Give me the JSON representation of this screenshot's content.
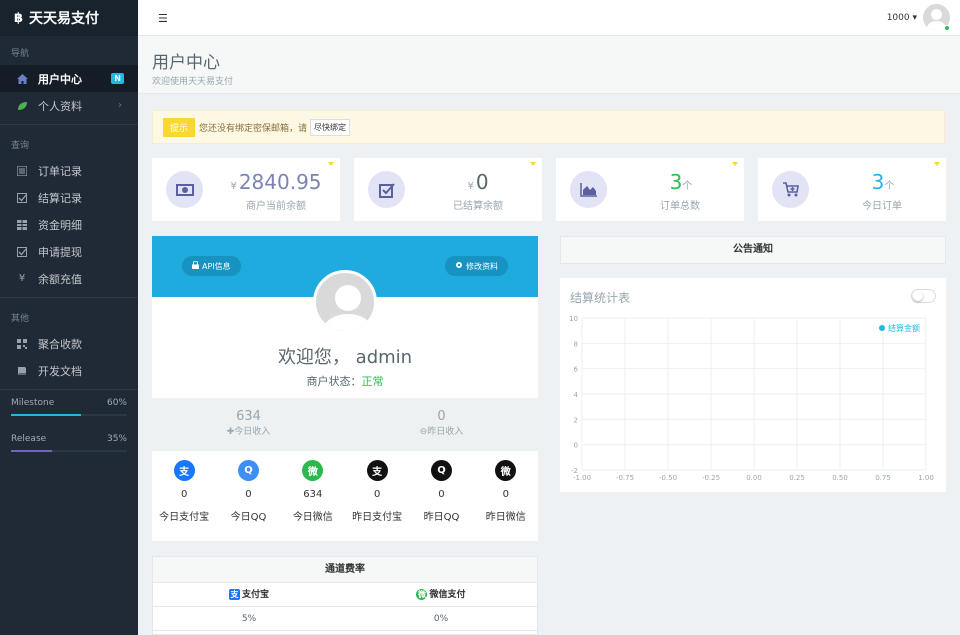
{
  "brand": {
    "logo": "฿",
    "name": "天天易支付"
  },
  "sidebar": {
    "section_nav": "导航",
    "nav_items": [
      {
        "label": "用户中心",
        "icon": "home-icon",
        "badge": "N",
        "active": true
      },
      {
        "label": "个人资料",
        "icon": "leaf-icon",
        "chevron": "›"
      }
    ],
    "section_query": "查询",
    "query_items": [
      {
        "label": "订单记录",
        "icon": "list-icon"
      },
      {
        "label": "结算记录",
        "icon": "check-icon"
      },
      {
        "label": "资金明细",
        "icon": "grid-icon"
      },
      {
        "label": "申请提现",
        "icon": "check-icon"
      },
      {
        "label": "余额充值",
        "icon": "yen-icon"
      }
    ],
    "section_other": "其他",
    "other_items": [
      {
        "label": "聚合收款",
        "icon": "qrcode-icon"
      },
      {
        "label": "开发文档",
        "icon": "book-icon"
      }
    ],
    "progress": [
      {
        "label": "Milestone",
        "percent_text": "60%",
        "value": 0.6,
        "color": "#23b7e5"
      },
      {
        "label": "Release",
        "percent_text": "35%",
        "value": 0.35,
        "color": "#7266ba"
      }
    ]
  },
  "header": {
    "menu_icon": "☰",
    "user": "1000 ▾"
  },
  "page": {
    "title": "用户中心",
    "subtitle": "欢迎使用天天易支付"
  },
  "alert": {
    "tag": "提示",
    "text": "您还没有绑定密保邮箱，请",
    "button": "尽快绑定"
  },
  "stats": [
    {
      "prefix": "¥",
      "value": "2840.95",
      "suffix": "",
      "label": "商户当前余额",
      "color": "#7a84b3",
      "icon": "money-icon"
    },
    {
      "prefix": "¥",
      "value": "0",
      "suffix": "",
      "label": "已结算余额",
      "color": "#58666e",
      "icon": "checkbox-icon"
    },
    {
      "prefix": "",
      "value": "3",
      "suffix": "个",
      "label": "订单总数",
      "color": "#27c24c",
      "icon": "area-chart-icon"
    },
    {
      "prefix": "",
      "value": "3",
      "suffix": "个",
      "label": "今日订单",
      "color": "#23b7e5",
      "icon": "cart-icon"
    }
  ],
  "profile": {
    "api_button": "API信息",
    "edit_button": "修改资料",
    "welcome": "欢迎您，  admin",
    "status_label": "商户状态：",
    "status_value": "正常",
    "income": [
      {
        "value": "634",
        "label": "今日收入",
        "icon": "plus-icon"
      },
      {
        "value": "0",
        "label": "昨日收入",
        "icon": "minus-circle-icon"
      }
    ],
    "channels": [
      {
        "value": "0",
        "label": "今日支付宝",
        "icon": "alipay-icon",
        "glyph": "支",
        "color": "#1677ff"
      },
      {
        "value": "0",
        "label": "今日QQ",
        "icon": "qq-icon",
        "glyph": "Q",
        "color": "#3f8ef5"
      },
      {
        "value": "634",
        "label": "今日微信",
        "icon": "wechat-icon",
        "glyph": "微",
        "color": "#2db84d"
      },
      {
        "value": "0",
        "label": "昨日支付宝",
        "icon": "alipay-icon",
        "glyph": "支",
        "color": "#111"
      },
      {
        "value": "0",
        "label": "昨日QQ",
        "icon": "qq-icon",
        "glyph": "Q",
        "color": "#111"
      },
      {
        "value": "0",
        "label": "昨日微信",
        "icon": "wechat-icon",
        "glyph": "微",
        "color": "#111"
      }
    ]
  },
  "rates": {
    "title": "通道费率",
    "headers": [
      {
        "label": "支付宝",
        "icon": "alipay-icon",
        "color": "#1677ff",
        "glyph": "支"
      },
      {
        "label": "微信支付",
        "icon": "wechat-icon",
        "color": "#2db84d",
        "glyph": "微"
      }
    ],
    "values": [
      "5%",
      "0%"
    ]
  },
  "notice": {
    "title": "公告通知"
  },
  "chart_data": {
    "type": "line",
    "title": "结算统计表",
    "series": [
      {
        "name": "结算金额",
        "values": []
      }
    ],
    "xlim": [
      -1.0,
      1.0
    ],
    "ylim": [
      -2,
      10
    ],
    "x_ticks": [
      "-1.00",
      "-0.75",
      "-0.50",
      "-0.25",
      "0.00",
      "0.25",
      "0.50",
      "0.75",
      "1.00"
    ],
    "y_ticks": [
      "10",
      "8",
      "6",
      "4",
      "2",
      "0",
      "-2"
    ],
    "grid": true,
    "legend": "top-right",
    "legend_color": "#23b7e5"
  }
}
